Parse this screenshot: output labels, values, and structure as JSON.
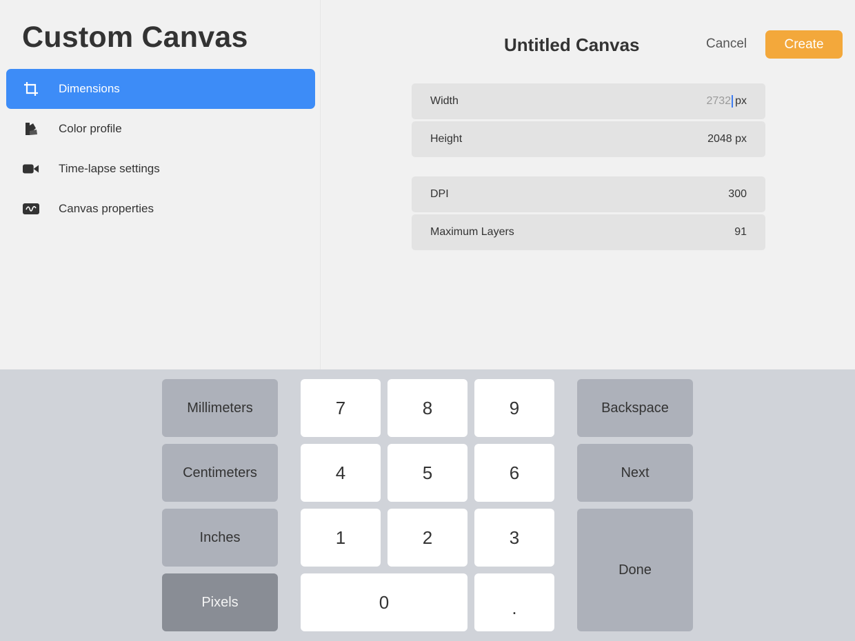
{
  "sidebar": {
    "title": "Custom Canvas",
    "items": [
      {
        "label": "Dimensions",
        "icon": "crop-icon",
        "active": true
      },
      {
        "label": "Color profile",
        "icon": "color-swatch-icon"
      },
      {
        "label": "Time-lapse settings",
        "icon": "video-camera-icon"
      },
      {
        "label": "Canvas properties",
        "icon": "waveform-icon"
      }
    ]
  },
  "header": {
    "title": "Untitled Canvas",
    "cancel_label": "Cancel",
    "create_label": "Create"
  },
  "fields": {
    "width": {
      "label": "Width",
      "value": "2732",
      "unit": "px"
    },
    "height": {
      "label": "Height",
      "value": "2048 px"
    },
    "dpi": {
      "label": "DPI",
      "value": "300"
    },
    "max_layers": {
      "label": "Maximum Layers",
      "value": "91"
    }
  },
  "keypad": {
    "units": [
      "Millimeters",
      "Centimeters",
      "Inches",
      "Pixels"
    ],
    "selected_unit": "Pixels",
    "digits": [
      "7",
      "8",
      "9",
      "4",
      "5",
      "6",
      "1",
      "2",
      "3",
      "0",
      "."
    ],
    "backspace_label": "Backspace",
    "next_label": "Next",
    "done_label": "Done"
  },
  "colors": {
    "accent": "#3d8cf7",
    "create": "#f3a83b"
  }
}
